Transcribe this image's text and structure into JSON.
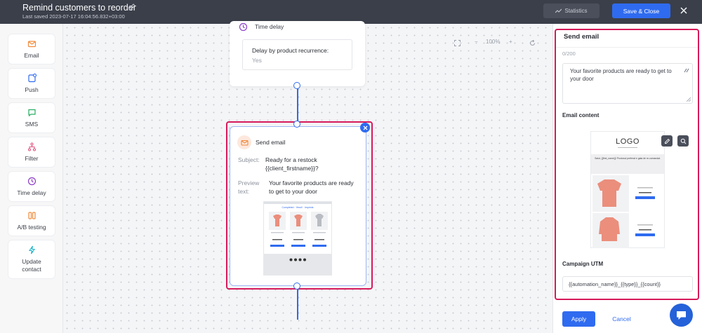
{
  "header": {
    "title": "Remind customers to reorder",
    "last_saved": "Last saved 2023-07-17 16:04:56.832+03:00",
    "statistics_label": "Statistics",
    "save_close_label": "Save & Close"
  },
  "sidebar": {
    "items": [
      {
        "label": "Email",
        "icon": "mail-icon"
      },
      {
        "label": "Push",
        "icon": "push-icon"
      },
      {
        "label": "SMS",
        "icon": "sms-icon"
      },
      {
        "label": "Filter",
        "icon": "filter-icon"
      },
      {
        "label": "Time delay",
        "icon": "clock-icon"
      },
      {
        "label": "A/B testing",
        "icon": "ab-testing-icon"
      },
      {
        "label": "Update contact",
        "icon": "lightning-icon"
      }
    ]
  },
  "canvas": {
    "zoom": "100%",
    "time_delay_node": {
      "title": "Time delay",
      "field_label": "Delay by product recurrence:",
      "field_value": "Yes"
    },
    "send_email_node": {
      "title": "Send email",
      "subject_label": "Subject:",
      "subject_value": "Ready for a restock {{client_firstname}}?",
      "preview_label": "Preview text:",
      "preview_value": "Your favorite products are ready to get to your door",
      "thumb_heading": "Completed · Yeezi! · Imprints"
    }
  },
  "panel": {
    "title": "Send email",
    "counter": "0/200",
    "preview_text": "Your favorite products are ready to get to your door",
    "email_content_label": "Email content",
    "logo_text": "LOGO",
    "greeting": "Salut, {{first_name}}! Produsul preferat e gata de re-comandat.",
    "buy_label": "Cumpără acum",
    "campaign_utm_label": "Campaign UTM",
    "utm_value": "{{automation_name}}_{{type}}_{{count}}",
    "apply_label": "Apply",
    "cancel_label": "Cancel"
  },
  "colors": {
    "primary": "#2f6bf0",
    "highlight": "#d6195b",
    "topbar": "#3b3f4a",
    "product": "#eb8e7c"
  }
}
